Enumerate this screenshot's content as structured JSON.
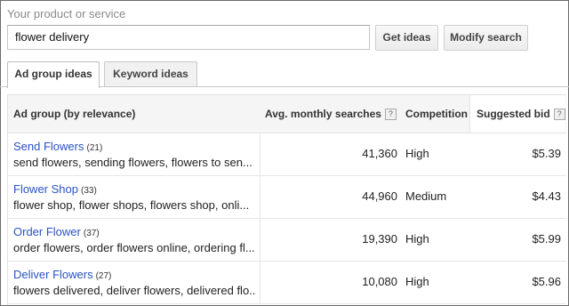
{
  "search": {
    "label": "Your product or service",
    "value": "flower delivery"
  },
  "buttons": {
    "get_ideas": "Get ideas",
    "modify_search": "Modify search"
  },
  "tabs": [
    {
      "label": "Ad group ideas",
      "active": true
    },
    {
      "label": "Keyword ideas",
      "active": false
    }
  ],
  "table": {
    "headers": {
      "ad_group": "Ad group (by relevance)",
      "avg_searches": "Avg. monthly searches",
      "competition": "Competition",
      "suggested_bid": "Suggested bid",
      "help": "?"
    },
    "rows": [
      {
        "name": "Send Flowers",
        "count": "(21)",
        "keywords": "send flowers, sending flowers, flowers to sen...",
        "searches": "41,360",
        "competition": "High",
        "bid": "$5.39"
      },
      {
        "name": "Flower Shop",
        "count": "(33)",
        "keywords": "flower shop, flower shops, flowers shop, onli...",
        "searches": "44,960",
        "competition": "Medium",
        "bid": "$4.43"
      },
      {
        "name": "Order Flower",
        "count": "(37)",
        "keywords": "order flowers, order flowers online, ordering fl...",
        "searches": "19,390",
        "competition": "High",
        "bid": "$5.99"
      },
      {
        "name": "Deliver Flowers",
        "count": "(27)",
        "keywords": "flowers delivered, deliver flowers, delivered flo...",
        "searches": "10,080",
        "competition": "High",
        "bid": "$5.96"
      }
    ]
  }
}
